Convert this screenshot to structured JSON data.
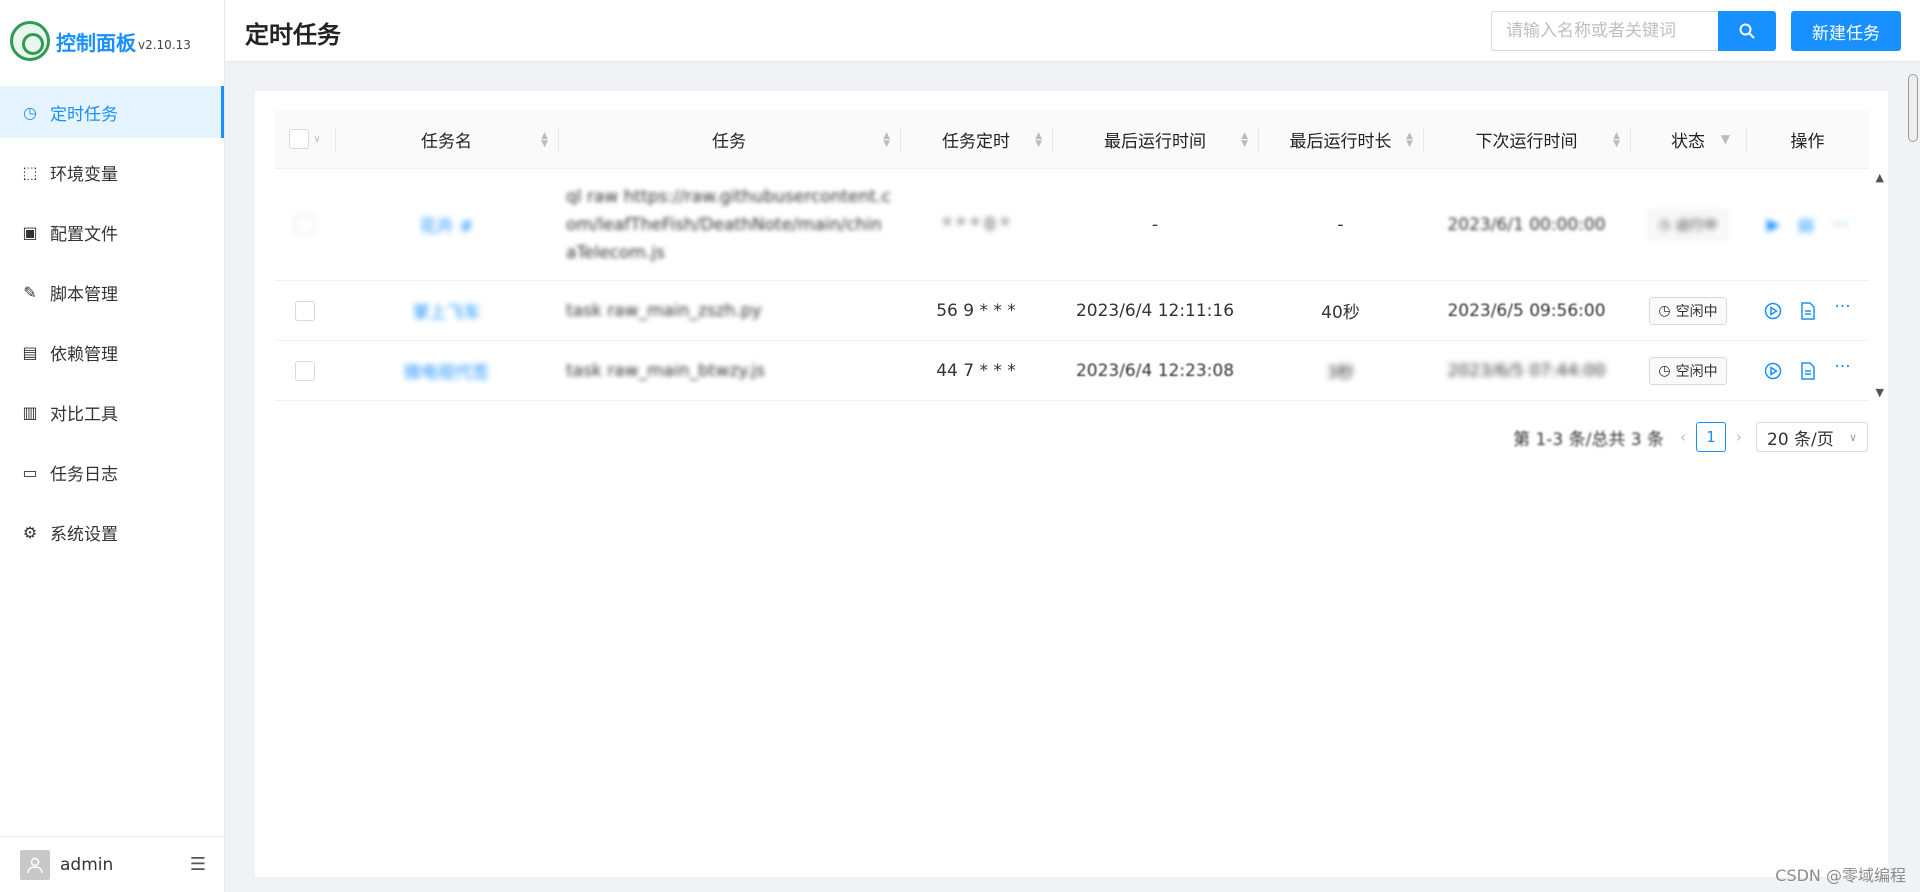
{
  "app": {
    "title": "控制面板",
    "version": "v2.10.13"
  },
  "sidebar": {
    "items": [
      {
        "label": "定时任务",
        "icon": "clock-icon",
        "active": true
      },
      {
        "label": "环境变量",
        "icon": "variable-icon"
      },
      {
        "label": "配置文件",
        "icon": "config-icon"
      },
      {
        "label": "脚本管理",
        "icon": "edit-icon"
      },
      {
        "label": "依赖管理",
        "icon": "package-icon"
      },
      {
        "label": "对比工具",
        "icon": "diff-icon"
      },
      {
        "label": "任务日志",
        "icon": "folder-icon"
      },
      {
        "label": "系统设置",
        "icon": "gear-icon"
      }
    ],
    "user": "admin"
  },
  "header": {
    "title": "定时任务",
    "search_placeholder": "请输入名称或者关键词",
    "new_button": "新建任务"
  },
  "table": {
    "columns": [
      "任务名",
      "任务",
      "任务定时",
      "最后运行时间",
      "最后运行时长",
      "下次运行时间",
      "状态",
      "操作"
    ],
    "rows": [
      {
        "name": "花卉 #",
        "command": "ql raw https://raw.githubusercontent.com/leafTheFish/DeathNote/main/chinaTelecom.js",
        "schedule": "* * * 0 *",
        "last_run": "-",
        "duration": "-",
        "next_run": "2023/6/1 00:00:00",
        "status": "运行中"
      },
      {
        "name": "掌上飞车",
        "command": "task raw_main_zszh.py",
        "schedule": "56 9 * * *",
        "last_run": "2023/6/4 12:11:16",
        "duration": "40秒",
        "next_run": "2023/6/5 09:56:00",
        "status": "空闲中"
      },
      {
        "name": "微电视代签",
        "command": "task raw_main_btwzy.js",
        "schedule": "44 7 * * *",
        "last_run": "2023/6/4 12:23:08",
        "duration": "3秒",
        "next_run": "2023/6/5 07:44:00",
        "status": "空闲中"
      }
    ]
  },
  "pagination": {
    "summary": "第 1-3 条/总共 3 条",
    "current": "1",
    "page_size": "20 条/页"
  },
  "watermark": "CSDN @零域编程"
}
